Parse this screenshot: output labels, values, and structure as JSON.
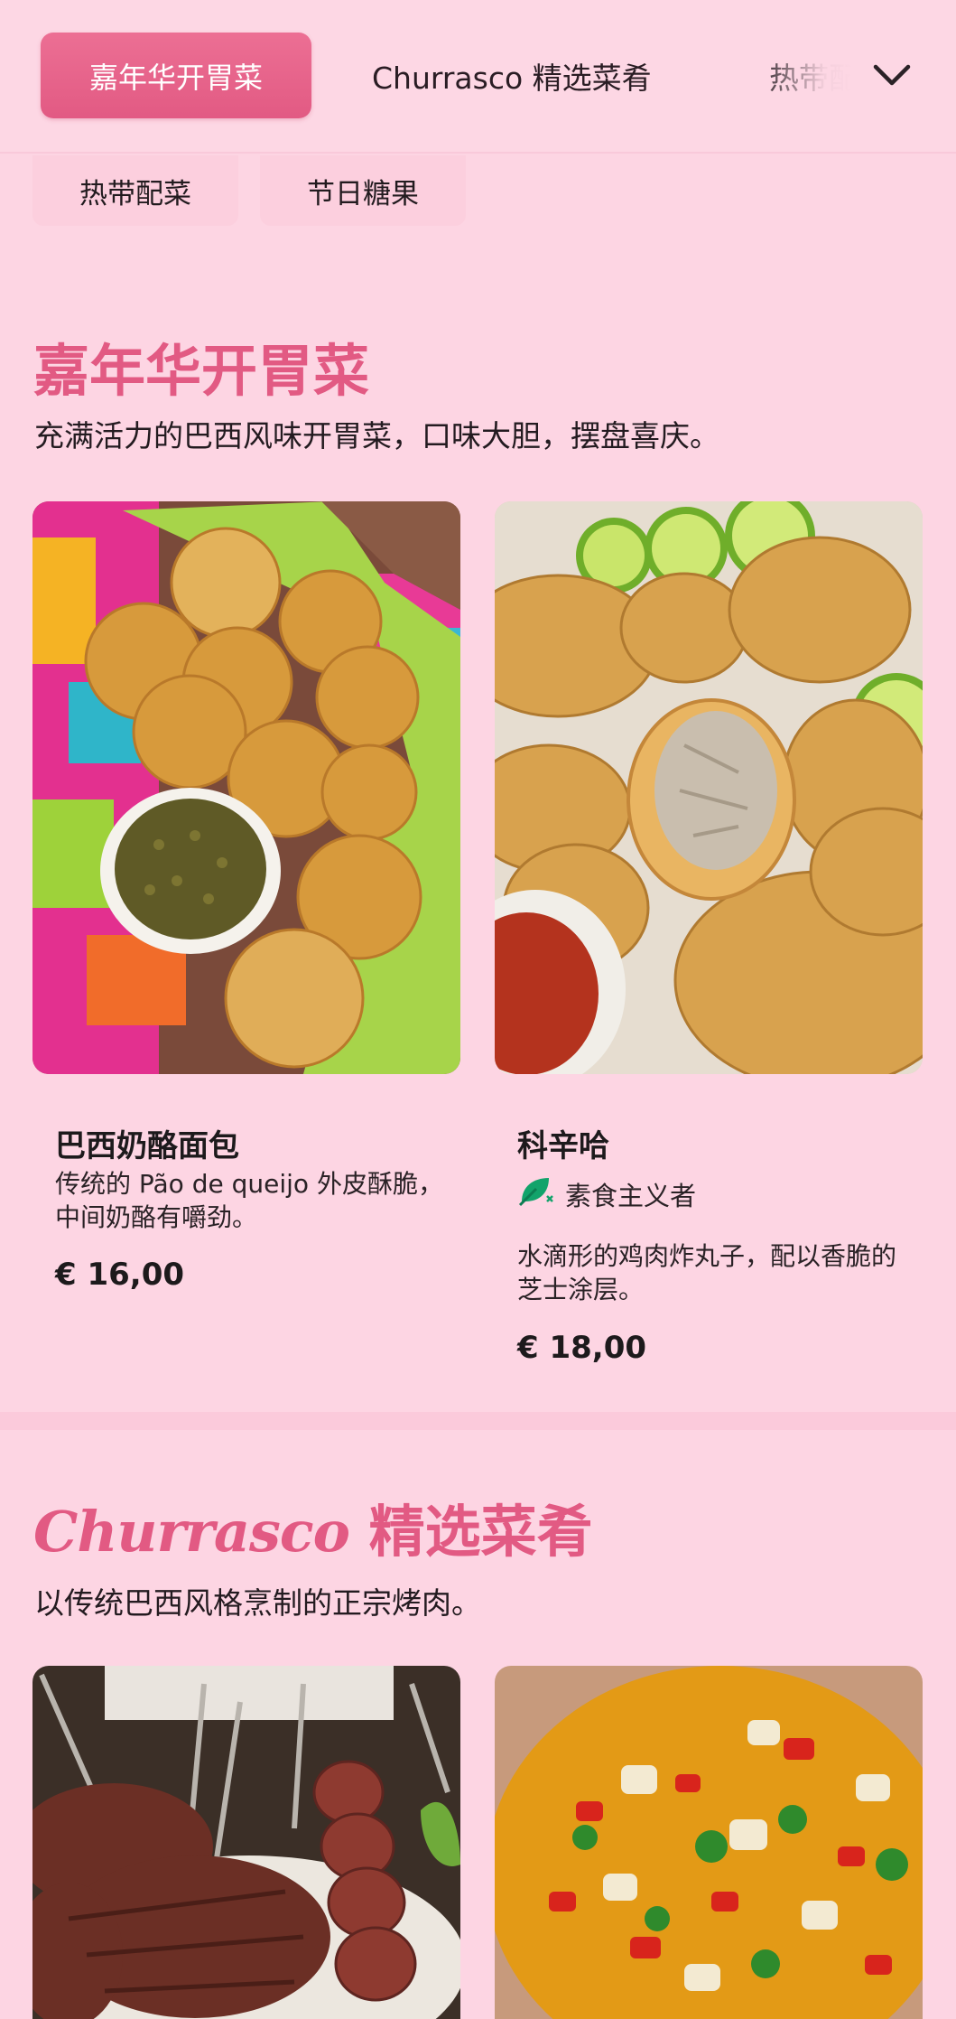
{
  "categories": {
    "active": "嘉年华开胃菜",
    "items": [
      "Churrasco 精选菜肴",
      "热带配菜",
      "节日糖果"
    ],
    "expand_icon": "chevron-down-icon"
  },
  "sections": [
    {
      "title": "嘉年华开胃菜",
      "description": "充满活力的巴西风味开胃菜，口味大胆，摆盘喜庆。",
      "cards": [
        {
          "name": "巴西奶酪面包",
          "description": "传统的 Pão de queijo 外皮酥脆，中间奶酪有嚼劲。",
          "price": "€ 16,00"
        },
        {
          "name": "科辛哈",
          "tag": "素食主义者",
          "tag_icon": "leaf-icon",
          "description": "水滴形的鸡肉炸丸子，配以香脆的芝士涂层。",
          "price": "€ 18,00"
        }
      ]
    },
    {
      "title_script": "Churrasco",
      "title_rest": " 精选菜肴",
      "description": "以传统巴西风格烹制的正宗烤肉。"
    }
  ],
  "colors": {
    "background": "#fdd5e3",
    "accent": "#e25a83",
    "vegan_tag": "#12a36b"
  }
}
